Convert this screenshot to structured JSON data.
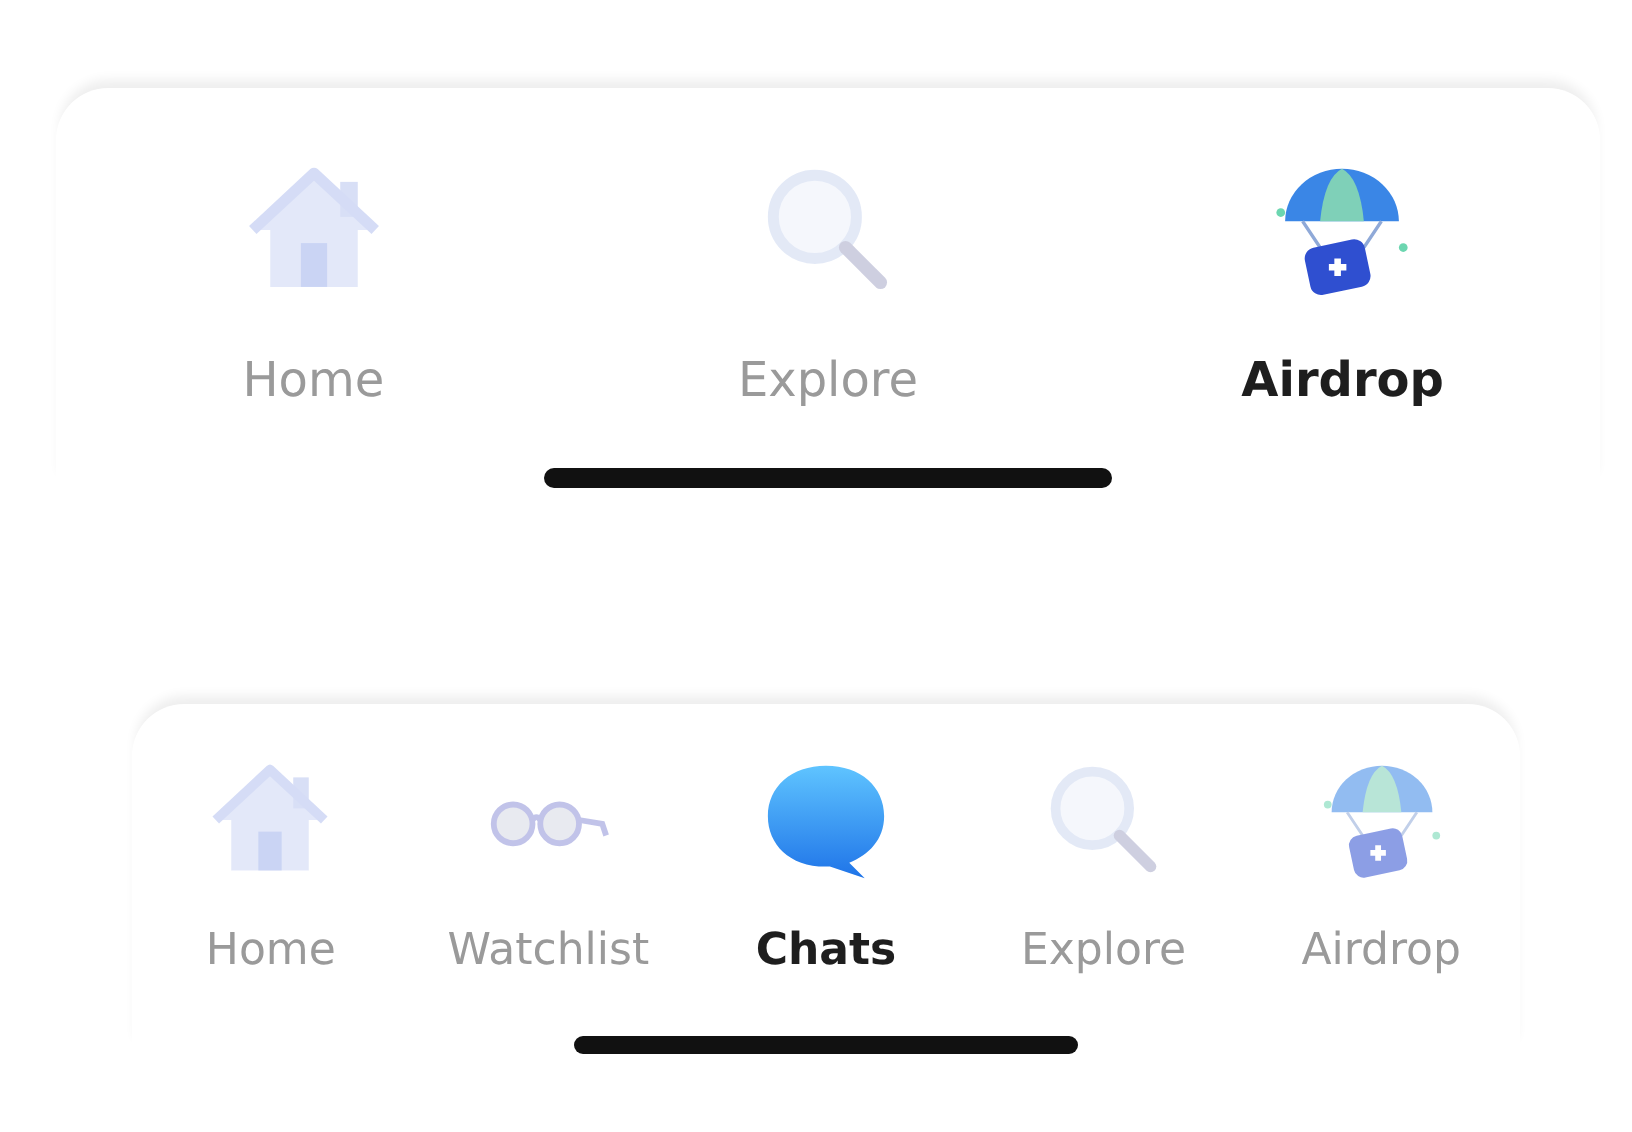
{
  "tab_bars": [
    {
      "tabs": [
        {
          "kind": "home",
          "label": "Home",
          "selected": false
        },
        {
          "kind": "explore",
          "label": "Explore",
          "selected": false
        },
        {
          "kind": "airdrop",
          "label": "Airdrop",
          "selected": true
        }
      ]
    },
    {
      "tabs": [
        {
          "kind": "home",
          "label": "Home",
          "selected": false
        },
        {
          "kind": "watchlist",
          "label": "Watchlist",
          "selected": false
        },
        {
          "kind": "chats",
          "label": "Chats",
          "selected": true
        },
        {
          "kind": "explore",
          "label": "Explore",
          "selected": false
        },
        {
          "kind": "airdrop",
          "label": "Airdrop",
          "selected": false
        }
      ]
    }
  ]
}
